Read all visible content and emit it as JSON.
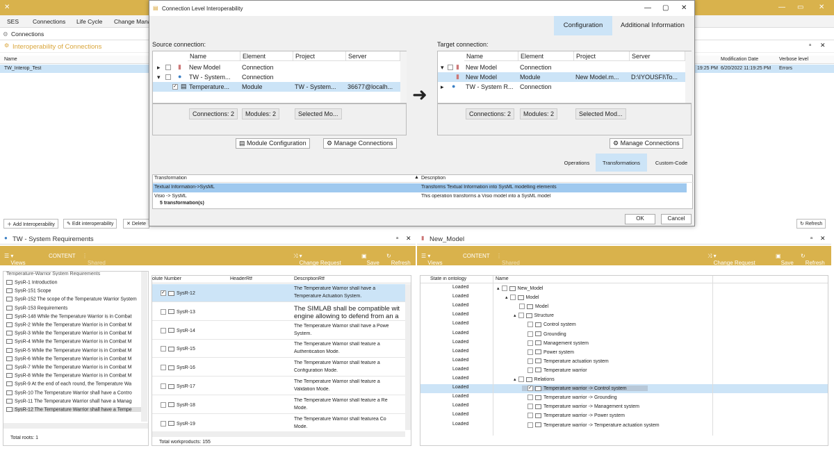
{
  "app": {
    "close_glyph": "✕"
  },
  "menu": {
    "items": [
      "SES",
      "Connections",
      "Life Cycle",
      "Change Mana"
    ]
  },
  "breadcrumb": "Connections",
  "interop": {
    "title": "Interoperability of Connections",
    "col_name": "Name",
    "col_mod": "Modification Date",
    "col_verbose": "Verbose level",
    "row_name": "TW_Interop_Test",
    "row_time1": "19:25 PM",
    "row_mod": "6/20/2022 11:19:25 PM",
    "row_verbose": "Errors"
  },
  "bottom_toolbar": {
    "add": "Add Interoperability",
    "edit": "Edit interoperability",
    "delete": "Delete",
    "refresh": "Refresh"
  },
  "dialog": {
    "title": "Connection Level Interoperability",
    "tabs": [
      "Configuration",
      "Additional Information"
    ],
    "source_label": "Source connection:",
    "target_label": "Target connection:",
    "columns": [
      "Name",
      "Element",
      "Project",
      "Server"
    ],
    "source_rows": [
      {
        "name": "New Model",
        "element": "Connection",
        "project": "",
        "server": ""
      },
      {
        "name": "TW - System...",
        "element": "Connection",
        "project": "",
        "server": ""
      },
      {
        "name": "Temperature...",
        "element": "Module",
        "project": "TW - System...",
        "server": "36677@localh..."
      }
    ],
    "target_rows": [
      {
        "name": "New Model",
        "element": "Connection",
        "project": "",
        "server": ""
      },
      {
        "name": "New Model",
        "element": "Module",
        "project": "New Model.m...",
        "server": "D:\\IYOUSFI\\To..."
      },
      {
        "name": "TW - System R...",
        "element": "Connection",
        "project": "",
        "server": ""
      }
    ],
    "source_counts": [
      "Connections: 2",
      "Modules: 2",
      "Selected Mo..."
    ],
    "target_counts": [
      "Connections: 2",
      "Modules: 2",
      "Selected Mod..."
    ],
    "module_config": "Module Configuration",
    "manage_conn": "Manage Connections",
    "arrow": "➜",
    "sub_tabs": [
      "Operations",
      "Transformations",
      "Custom-Code"
    ],
    "trans_cols": [
      "Transformation",
      "Description"
    ],
    "trans_rows": [
      {
        "t": "Textual Information->SysML",
        "d": "Transforms Textual Information into SysML modelling elements"
      },
      {
        "t": "Visio -> SysML",
        "d": "This operation transforms a Visio model into a SysML model"
      }
    ],
    "trans_count": "5 transformation(s)",
    "ok": "OK",
    "cancel": "Cancel"
  },
  "left_panel": {
    "title": "TW - System Requirements",
    "views": "Views",
    "content": "CONTENT",
    "shared": "Shared",
    "change_request": "Change Request",
    "save": "Save",
    "refresh": "Refresh",
    "tree": [
      "SysR-1 Introduction",
      "SysR-151 Scope",
      "SysR-152 The scope of the Temperature Warrior System",
      "SysR-153 Requirements",
      "SysR-148 While the Temperature Warrior is in Combat",
      "SysR-2 While the Temperature Warrior is in Combat M",
      "SysR-3 While the Temperature Warrior is in Combat M",
      "SysR-4 While the Temperature Warrior is in Combat M",
      "SysR-5 While the Temperature Warrior is in Combat M",
      "SysR-6 While the Temperature Warrior is in Combat M",
      "SysR-7 While the Temperature Warrior is in Combat M",
      "SysR-8 While the Temperature Warrior is in Combat M",
      "SysR-9 At the end of each round, the Temperature Wa",
      "SysR-10 The Temperature Warrior shall have a Contro",
      "SysR-11 The Temperature Warrior shall have a Manag",
      "SysR-12 The Temperature Warrior shall have a Tempe"
    ],
    "tree_top": "Temperature-Warrior System Requirements",
    "total_roots": "Total roots: 1",
    "table_cols": [
      "olute Number",
      "HeaderRtf",
      "DescriptionRtf"
    ],
    "rows": [
      {
        "id": "SysR-12",
        "d1": "The Temperature Warrior shall have a",
        "d2": "Temperature Actuation System."
      },
      {
        "id": "SysR-13",
        "d1": "The SIMLAB shall be compatible wit",
        "d2": "engine allowing to defend from an a"
      },
      {
        "id": "SysR-14",
        "d1": "The Temperature Warrior shall have a Powe",
        "d2": "System."
      },
      {
        "id": "SysR-15",
        "d1": "The Temperature Warrior shall feature a",
        "d2": "Authentication Mode."
      },
      {
        "id": "SysR-16",
        "d1": "The Temperature Warrior shall feature a",
        "d2": "Configuration Mode."
      },
      {
        "id": "SysR-17",
        "d1": "The Temperature Warrior shall feature a",
        "d2": "Validation Mode."
      },
      {
        "id": "SysR-18",
        "d1": "The Temperature Warrior shall feature a Re",
        "d2": "Mode."
      },
      {
        "id": "SysR-19",
        "d1": "The Temperature Warrior shall featurea Co",
        "d2": "Mode."
      }
    ],
    "total_wp": "Total workproducts: 155"
  },
  "right_panel": {
    "title": "New_Model",
    "views": "Views",
    "content": "CONTENT",
    "shared": "Shared",
    "change_request": "Change Request",
    "save": "Save",
    "refresh": "Refresh",
    "cols": [
      "State in ontology",
      "Name"
    ],
    "state": "Loaded",
    "tree": [
      "New_Model",
      "Model",
      "Model",
      "Structure",
      "Control system",
      "Grounding",
      "Management system",
      "Power system",
      "Temperature actuation system",
      "Temperature warrior",
      "Relations",
      "Temperature warrior -> Control system",
      "Temperature warrior -> Grounding",
      "Temperature warrior -> Management system",
      "Temperature warrior -> Power system",
      "Temperature warrior -> Temperature actuation system"
    ]
  }
}
